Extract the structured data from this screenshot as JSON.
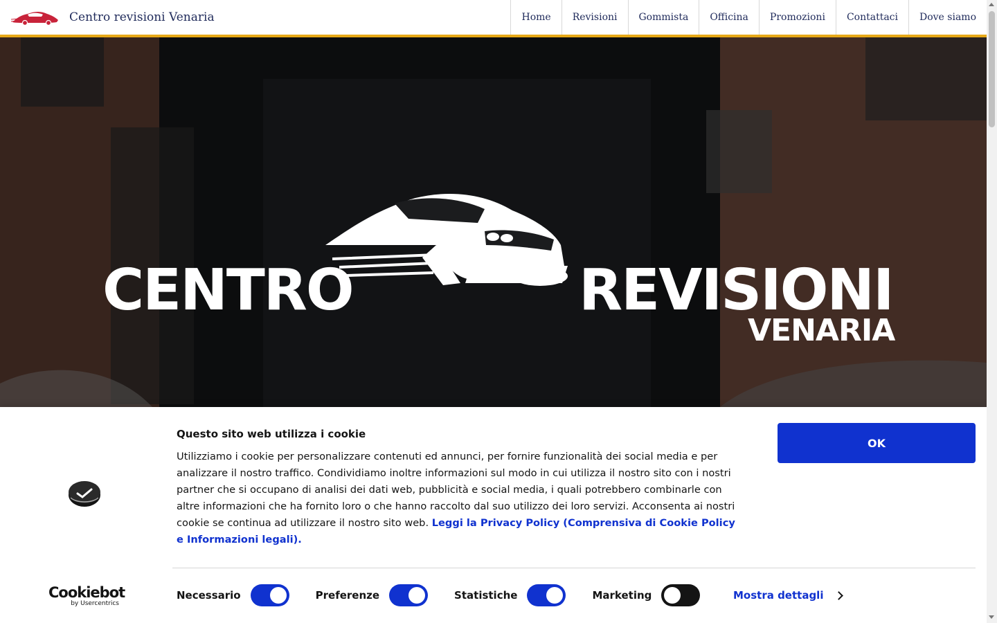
{
  "header": {
    "title": "Centro revisioni Venaria",
    "nav": [
      "Home",
      "Revisioni",
      "Gommista",
      "Officina",
      "Promozioni",
      "Contattaci",
      "Dove siamo"
    ],
    "accent_color": "#e6a817"
  },
  "hero": {
    "word_left": "CENTRO",
    "word_right": "REVISIONI",
    "word_sub": "VENARIA"
  },
  "cookie_banner": {
    "title": "Questo sito web utilizza i cookie",
    "body": "Utilizziamo i cookie per personalizzare contenuti ed annunci, per fornire funzionalità dei social media e per analizzare il nostro traffico. Condividiamo inoltre informazioni sul modo in cui utilizza il nostro sito con i nostri partner che si occupano di analisi dei dati web, pubblicità e social media, i quali potrebbero combinarle con altre informazioni che ha fornito loro o che hanno raccolto dal suo utilizzo dei loro servizi. Acconsenta ai nostri cookie se continua ad utilizzare il nostro sito web.",
    "link_text": "Leggi la Privacy Policy (Comprensiva di Cookie Policy e Informazioni legali).",
    "ok_label": "OK",
    "brand_main": "Cookiebot",
    "brand_sub": "by Usercentrics",
    "toggles": [
      {
        "label": "Necessario",
        "state": "on"
      },
      {
        "label": "Preferenze",
        "state": "on"
      },
      {
        "label": "Statistiche",
        "state": "on"
      },
      {
        "label": "Marketing",
        "state": "off"
      }
    ],
    "details_label": "Mostra dettagli",
    "primary_color": "#1032cf"
  }
}
